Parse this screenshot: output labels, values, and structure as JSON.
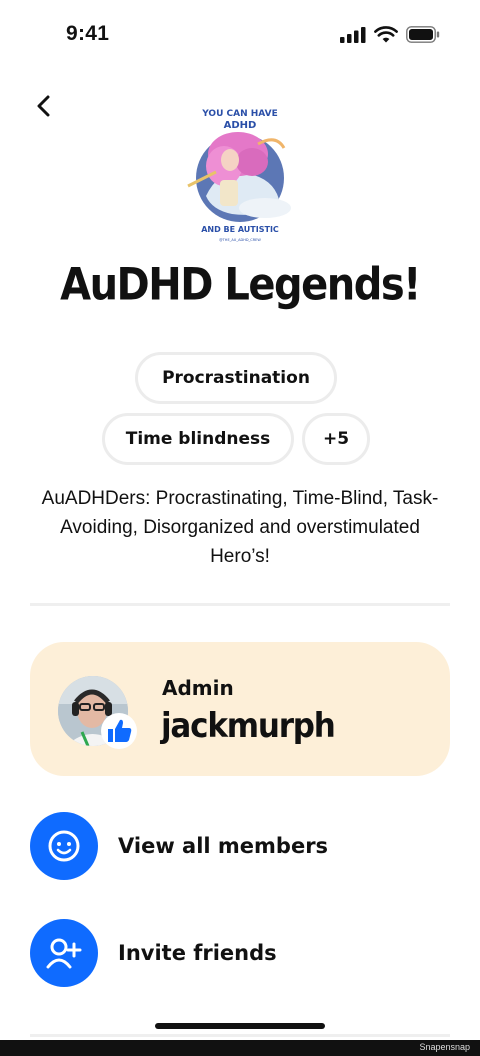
{
  "status_bar": {
    "time": "9:41"
  },
  "group": {
    "image_lines": [
      "YOU CAN HAVE",
      "ADHD",
      "AND BE AUTISTIC"
    ],
    "image_credit": "@THE_AU_ADHD_CREW",
    "title": "AuDHD Legends!",
    "tags": [
      "Procrastination",
      "Time blindness",
      "+5"
    ],
    "description": "AuADHDers: Procrastinating, Time-Blind, Task-Avoiding, Disorganized and overstimulated Hero’s!"
  },
  "admin": {
    "label": "Admin",
    "name": "jackmurph"
  },
  "actions": {
    "members": "View all members",
    "invite": "Invite friends"
  },
  "footer": {
    "watermark": "Snapensnap"
  },
  "colors": {
    "accent": "#0f6bff",
    "admin_card": "#fdefd8",
    "chip_border": "#ececec"
  }
}
